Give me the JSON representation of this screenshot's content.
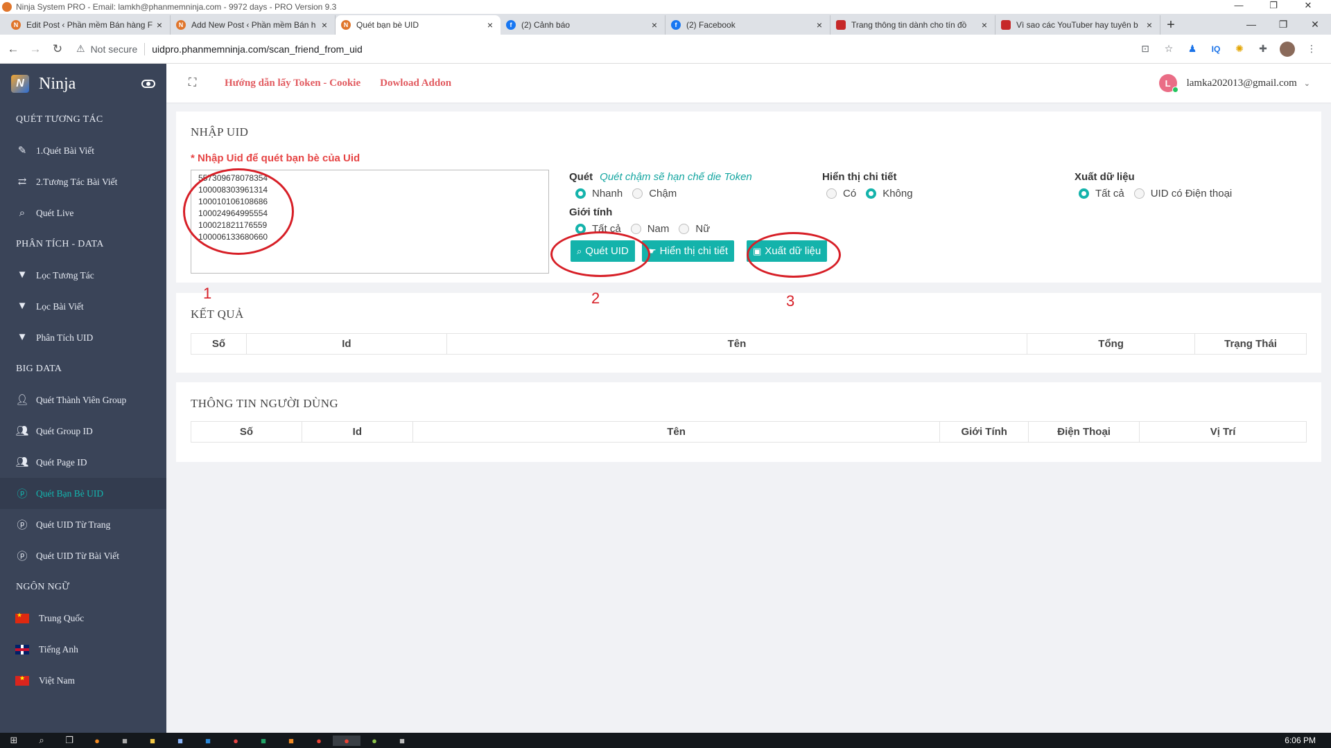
{
  "window": {
    "title": "Ninja System PRO - Email: lamkh@phanmemninja.com - 9972 days - PRO Version 9.3",
    "controls": [
      "—",
      "❐",
      "✕"
    ]
  },
  "tabs": [
    {
      "label": "Edit Post ‹ Phần mềm Bán hàng F",
      "icon": "ninja-icon",
      "active": false
    },
    {
      "label": "Add New Post ‹ Phần mềm Bán h",
      "icon": "ninja-icon",
      "active": false
    },
    {
      "label": "Quét bạn bè UID",
      "icon": "ninja-icon",
      "active": true
    },
    {
      "label": "(2) Cảnh báo",
      "icon": "facebook-icon",
      "active": false
    },
    {
      "label": "(2) Facebook",
      "icon": "facebook-icon",
      "active": false
    },
    {
      "label": "Trang thông tin dành cho tín đồ",
      "icon": "news-icon",
      "active": false
    },
    {
      "label": "Vì sao các YouTuber hay tuyên b",
      "icon": "news-icon",
      "active": false
    }
  ],
  "address": {
    "security": "Not secure",
    "url": "uidpro.phanmemninja.com/scan_friend_from_uid"
  },
  "brand": {
    "name": "Ninja"
  },
  "sidebar": {
    "sections": [
      {
        "title": "QUÉT TƯƠNG TÁC",
        "items": [
          {
            "label": "1.Quét Bài Viết",
            "icon": "edit-icon"
          },
          {
            "label": "2.Tương Tác Bài Viết",
            "icon": "exchange-icon"
          },
          {
            "label": "Quét Live",
            "icon": "search-icon"
          }
        ]
      },
      {
        "title": "PHÂN TÍCH - DATA",
        "items": [
          {
            "label": "Lọc Tương Tác",
            "icon": "filter-icon"
          },
          {
            "label": "Lọc Bài Viết",
            "icon": "filter-icon"
          },
          {
            "label": "Phân Tích UID",
            "icon": "filter-icon"
          }
        ]
      },
      {
        "title": "BIG DATA",
        "items": [
          {
            "label": "Quét Thành Viên Group",
            "icon": "user-icon"
          },
          {
            "label": "Quét Group ID",
            "icon": "users-icon"
          },
          {
            "label": "Quét Page ID",
            "icon": "users-icon"
          },
          {
            "label": "Quét Bạn Bè UID",
            "icon": "pinterest-icon",
            "active": true
          },
          {
            "label": "Quét UID Từ Trang",
            "icon": "pinterest-icon"
          },
          {
            "label": "Quét UID Từ Bài Viết",
            "icon": "pinterest-icon"
          }
        ]
      },
      {
        "title": "NGÔN NGỮ",
        "items": [
          {
            "label": "Trung Quốc",
            "icon": "flag-cn"
          },
          {
            "label": "Tiếng Anh",
            "icon": "flag-uk"
          },
          {
            "label": "Việt Nam",
            "icon": "flag-vn"
          }
        ]
      }
    ]
  },
  "header": {
    "link_token": "Hướng dẫn lấy Token - Cookie",
    "link_addon": "Dowload Addon",
    "avatar_letter": "L",
    "user_email": "lamka202013@gmail.com"
  },
  "input_panel": {
    "title": "NHẬP UID",
    "required_label": "* Nhập Uid để quét bạn bè của Uid",
    "uids": "557309678078354\n100008303961314\n100010106108686\n100024964995554\n100021821176559\n100006133680660",
    "scan": {
      "label": "Quét",
      "hint": "Quét chậm sẽ hạn chế die Token",
      "options": [
        "Nhanh",
        "Chậm"
      ],
      "selected": "Nhanh"
    },
    "detail": {
      "label": "Hiển thị chi tiết",
      "options": [
        "Có",
        "Không"
      ],
      "selected": "Không"
    },
    "export": {
      "label": "Xuất dữ liệu",
      "options": [
        "Tất cả",
        "UID có Điện thoại"
      ],
      "selected": "Tất cả"
    },
    "gender": {
      "label": "Giới tính",
      "options": [
        "Tất cả",
        "Nam",
        "Nữ"
      ],
      "selected": "Tất cả"
    },
    "buttons": {
      "scan": "Quét UID",
      "show_detail": "Hiển thị chi tiết",
      "export": "Xuất dữ liệu"
    }
  },
  "annotations": [
    "1",
    "2",
    "3"
  ],
  "results_panel": {
    "title": "KẾT QUẢ",
    "columns": [
      "Số",
      "Id",
      "Tên",
      "Tổng",
      "Trạng Thái"
    ]
  },
  "user_panel": {
    "title": "THÔNG TIN NGƯỜI DÙNG",
    "columns": [
      "Số",
      "Id",
      "Tên",
      "Giới Tính",
      "Điện Thoại",
      "Vị Trí"
    ]
  },
  "taskbar": {
    "clock": "6:06 PM"
  },
  "colors": {
    "accent": "#14b3ab",
    "sidebar": "#3a4458",
    "link": "#e1595e",
    "annotation": "#d71f27"
  }
}
